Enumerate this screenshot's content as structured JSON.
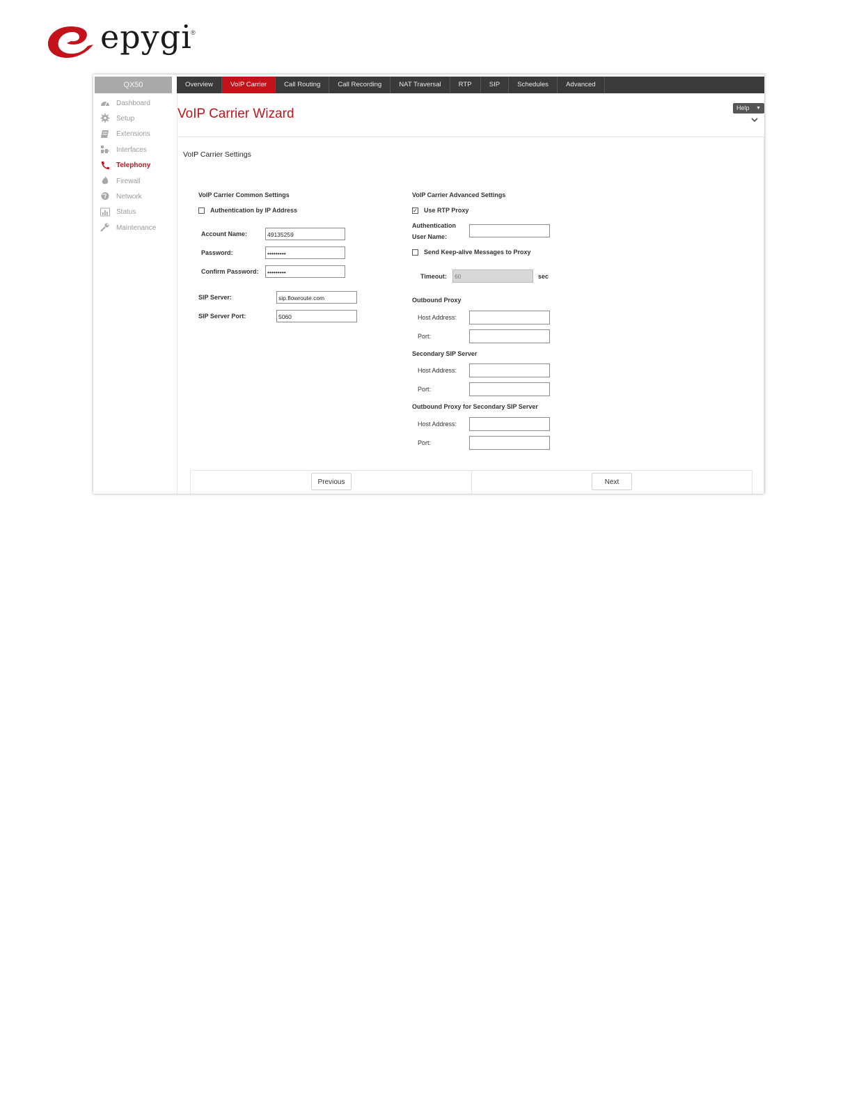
{
  "brand": {
    "name": "epygi",
    "reg": "®",
    "accent": "#c3121a"
  },
  "sidebar": {
    "device": "QX50",
    "items": [
      {
        "label": "Dashboard",
        "icon": "dashboard-icon"
      },
      {
        "label": "Setup",
        "icon": "gear-icon"
      },
      {
        "label": "Extensions",
        "icon": "extensions-icon"
      },
      {
        "label": "Interfaces",
        "icon": "interfaces-icon"
      },
      {
        "label": "Telephony",
        "icon": "phone-icon",
        "active": true
      },
      {
        "label": "Firewall",
        "icon": "fire-icon"
      },
      {
        "label": "Network",
        "icon": "globe-icon"
      },
      {
        "label": "Status",
        "icon": "chart-icon"
      },
      {
        "label": "Maintenance",
        "icon": "wrench-icon"
      }
    ]
  },
  "tabs": [
    "Overview",
    "VoIP Carrier",
    "Call Routing",
    "Call Recording",
    "NAT Traversal",
    "RTP",
    "SIP",
    "Schedules",
    "Advanced"
  ],
  "active_tab": "VoIP Carrier",
  "header": {
    "title": "VoIP Carrier Wizard",
    "help": "Help"
  },
  "section_title": "VoIP Carrier Settings",
  "common": {
    "heading": "VoIP Carrier Common Settings",
    "auth_by_ip": {
      "label": "Authentication by IP Address",
      "checked": false
    },
    "account_name": {
      "label": "Account Name:",
      "value": "49135259"
    },
    "password": {
      "label": "Password:",
      "value": "•••••••••"
    },
    "confirm_password": {
      "label": "Confirm Password:",
      "value": "•••••••••"
    },
    "sip_server": {
      "label": "SIP Server:",
      "value": "sip.flowroute.com"
    },
    "sip_server_port": {
      "label": "SIP Server Port:",
      "value": "5060"
    }
  },
  "advanced": {
    "heading": "VoIP Carrier Advanced Settings",
    "use_rtp_proxy": {
      "label": "Use RTP Proxy",
      "checked": true
    },
    "auth_user_line1": "Authentication",
    "auth_user_line2": "User Name:",
    "auth_user_value": "",
    "keepalive": {
      "label": "Send Keep-alive Messages to Proxy",
      "checked": false
    },
    "timeout": {
      "label": "Timeout:",
      "value": "60",
      "unit": "sec"
    },
    "outbound_proxy": {
      "heading": "Outbound Proxy",
      "host_label": "Host Address:",
      "port_label": "Port:"
    },
    "secondary_sip": {
      "heading": "Secondary SIP Server",
      "host_label": "Host Address:",
      "port_label": "Port:"
    },
    "outbound_secondary": {
      "heading": "Outbound Proxy for Secondary SIP Server",
      "host_label": "Host Address:",
      "port_label": "Port:"
    }
  },
  "nav": {
    "previous": "Previous",
    "next": "Next"
  }
}
